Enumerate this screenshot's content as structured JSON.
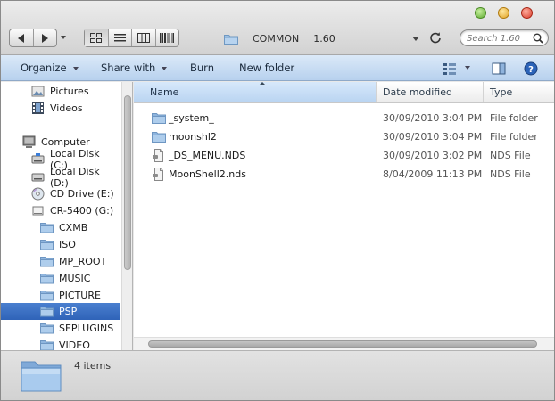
{
  "window": {
    "path": {
      "folder": "COMMON",
      "version": "1.60"
    },
    "search": {
      "placeholder": "Search 1.60"
    }
  },
  "commands": {
    "organize": "Organize",
    "share_with": "Share with",
    "burn": "Burn",
    "new_folder": "New folder"
  },
  "sidebar": {
    "items": [
      {
        "label": "Pictures",
        "icon": "pictures-icon"
      },
      {
        "label": "Videos",
        "icon": "videos-icon"
      },
      {
        "label": "Computer",
        "icon": "computer-icon"
      },
      {
        "label": "Local Disk (C:)",
        "icon": "drive-icon"
      },
      {
        "label": "Local Disk (D:)",
        "icon": "drive-icon"
      },
      {
        "label": "CD Drive (E:)",
        "icon": "cd-drive-icon"
      },
      {
        "label": "CR-5400 (G:)",
        "icon": "removable-drive-icon"
      },
      {
        "label": "CXMB",
        "icon": "folder-icon"
      },
      {
        "label": "ISO",
        "icon": "folder-icon"
      },
      {
        "label": "MP_ROOT",
        "icon": "folder-icon"
      },
      {
        "label": "MUSIC",
        "icon": "folder-icon"
      },
      {
        "label": "PICTURE",
        "icon": "folder-icon"
      },
      {
        "label": "PSP",
        "icon": "folder-icon",
        "selected": true
      },
      {
        "label": "SEPLUGINS",
        "icon": "folder-icon"
      },
      {
        "label": "VIDEO",
        "icon": "folder-icon"
      }
    ]
  },
  "columns": {
    "name": "Name",
    "date": "Date modified",
    "type": "Type"
  },
  "files": [
    {
      "name": "_system_",
      "date": "30/09/2010 3:04 PM",
      "type": "File folder",
      "icon": "folder-icon"
    },
    {
      "name": "moonshl2",
      "date": "30/09/2010 3:04 PM",
      "type": "File folder",
      "icon": "folder-icon"
    },
    {
      "name": "_DS_MENU.NDS",
      "date": "30/09/2010 3:02 PM",
      "type": "NDS File",
      "icon": "file-icon"
    },
    {
      "name": "MoonShell2.nds",
      "date": "8/04/2009 11:13 PM",
      "type": "NDS File",
      "icon": "file-icon"
    }
  ],
  "status": {
    "item_count": "4 items"
  },
  "colors": {
    "selection": "#3a6fc4",
    "command_bar": "#c8ddf3",
    "sorted_column": "#c8ddf3"
  }
}
